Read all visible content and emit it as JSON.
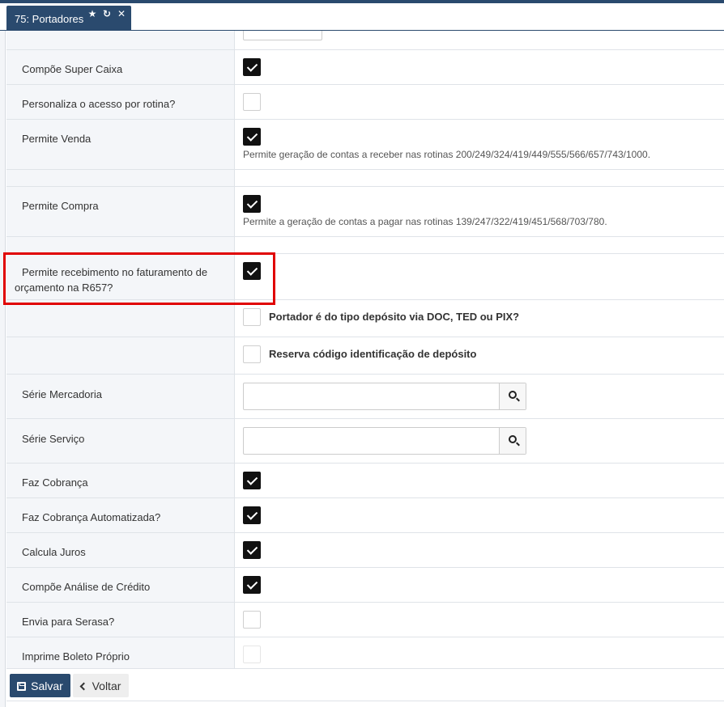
{
  "tab": {
    "title": "75: Portadores",
    "icons": [
      "star-icon",
      "refresh-icon",
      "close-icon"
    ]
  },
  "rows": {
    "compoe_super_caixa": {
      "label": "Compõe Super Caixa",
      "checked": true
    },
    "personaliza_acesso": {
      "label": "Personaliza o acesso por rotina?",
      "checked": false
    },
    "permite_venda": {
      "label": "Permite Venda",
      "checked": true,
      "help": "Permite geração de contas a receber nas rotinas 200/249/324/419/449/555/566/657/743/1000."
    },
    "permite_compra": {
      "label": "Permite Compra",
      "checked": true,
      "help": "Permite a geração de contas a pagar nas rotinas 139/247/322/419/451/568/703/780."
    },
    "permite_recebimento": {
      "label_line1": "Permite recebimento no faturamento de",
      "label_line2": "orçamento na R657?",
      "checked": true
    },
    "tipo_deposito": {
      "label": "Portador é do tipo depósito via DOC, TED ou PIX?",
      "checked": false
    },
    "reserva_codigo": {
      "label": "Reserva código identificação de depósito",
      "checked": false
    },
    "serie_mercadoria": {
      "label": "Série Mercadoria",
      "value": ""
    },
    "serie_servico": {
      "label": "Série Serviço",
      "value": ""
    },
    "faz_cobranca": {
      "label": "Faz Cobrança",
      "checked": true
    },
    "faz_cobranca_auto": {
      "label": "Faz Cobrança Automatizada?",
      "checked": true
    },
    "calcula_juros": {
      "label": "Calcula Juros",
      "checked": true
    },
    "compoe_analise": {
      "label": "Compõe Análise de Crédito",
      "checked": true
    },
    "envia_serasa": {
      "label": "Envia para Serasa?",
      "checked": false
    },
    "imprime_boleto": {
      "label": "Imprime Boleto Próprio",
      "checked": false
    }
  },
  "footer": {
    "save_label": "Salvar",
    "back_label": "Voltar"
  },
  "colors": {
    "primary": "#2a4a6e",
    "highlight": "#e00000"
  }
}
